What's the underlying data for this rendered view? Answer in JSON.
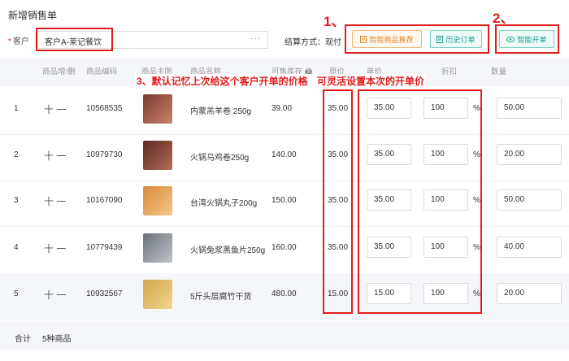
{
  "title": "新增销售单",
  "customer": {
    "label": "客户",
    "required_mark": "*",
    "value": "客户A-莱记餐饮",
    "more_icon": "ellipsis-icon"
  },
  "settlement": {
    "label": "结算方式：现付"
  },
  "buttons": {
    "smart_recommend": "智能商品推荐",
    "history_orders": "历史订单",
    "smart_open": "智能开单"
  },
  "annotations": {
    "one": "1、",
    "two": "2、",
    "three": "3、默认记忆上次给这个客户开单的价格",
    "three_b": "可灵活设置本次的开单价"
  },
  "columns": {
    "add_del": "商品增/删",
    "code": "商品编码",
    "image": "商品主图",
    "name": "商品名称",
    "stock": "可售库存",
    "orig_price": "原价",
    "unit_price": "单价",
    "discount": "折扣",
    "quantity": "数量"
  },
  "rows": [
    {
      "idx": "1",
      "pm": "十 一",
      "code": "10568535",
      "name": "内蒙羔羊卷 250g",
      "stock": "39.00",
      "orig": "35.00",
      "price": "35.00",
      "discount": "100",
      "pct": "%",
      "qty": "50.00"
    },
    {
      "idx": "2",
      "pm": "十 一",
      "code": "10979730",
      "name": "火锅乌鸡卷250g",
      "stock": "140.00",
      "orig": "35.00",
      "price": "35.00",
      "discount": "100",
      "pct": "%",
      "qty": "20.00"
    },
    {
      "idx": "3",
      "pm": "十 一",
      "code": "10167090",
      "name": "台湾火锅丸子200g",
      "stock": "150.00",
      "orig": "35.00",
      "price": "35.00",
      "discount": "100",
      "pct": "%",
      "qty": "50.00"
    },
    {
      "idx": "4",
      "pm": "十 一",
      "code": "10779439",
      "name": "火锅兔浆黑鱼片250g",
      "stock": "160.00",
      "orig": "35.00",
      "price": "35.00",
      "discount": "100",
      "pct": "%",
      "qty": "40.00"
    },
    {
      "idx": "5",
      "pm": "十 一",
      "code": "10932567",
      "name": "5斤头层腐竹干货",
      "stock": "480.00",
      "orig": "15.00",
      "price": "15.00",
      "discount": "100",
      "pct": "%",
      "qty": "20.00"
    }
  ],
  "footer": {
    "total_label": "合计",
    "count": "5种商品"
  }
}
